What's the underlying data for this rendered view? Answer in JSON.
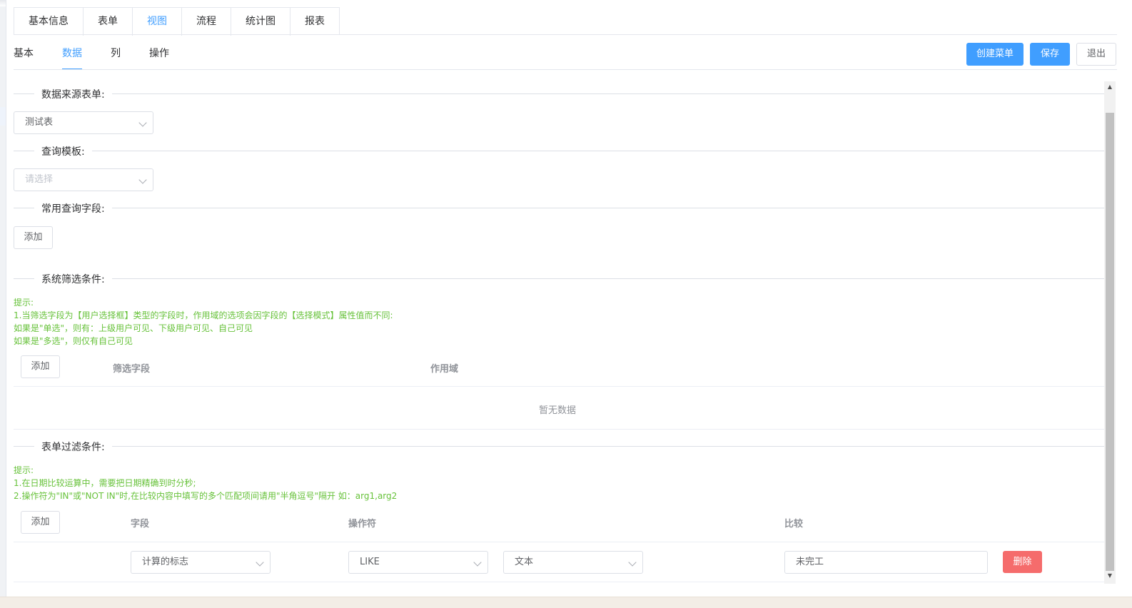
{
  "top_tabs": [
    {
      "label": "基本信息"
    },
    {
      "label": "表单"
    },
    {
      "label": "视图",
      "active": true
    },
    {
      "label": "流程"
    },
    {
      "label": "统计图"
    },
    {
      "label": "报表"
    }
  ],
  "sub_tabs": [
    {
      "label": "基本"
    },
    {
      "label": "数据",
      "active": true
    },
    {
      "label": "列"
    },
    {
      "label": "操作"
    }
  ],
  "toolbar": {
    "create_menu_label": "创建菜单",
    "save_label": "保存",
    "exit_label": "退出"
  },
  "data_source": {
    "section_title": "数据来源表单:",
    "selected_value": "测试表"
  },
  "query_template": {
    "section_title": "查询模板:",
    "placeholder": "请选择"
  },
  "common_query_fields": {
    "section_title": "常用查询字段:",
    "add_label": "添加"
  },
  "system_filter": {
    "section_title": "系统筛选条件:",
    "hint_lines": [
      "提示:",
      "1.当筛选字段为【用户选择框】类型的字段时，作用域的选项会因字段的【选择模式】属性值而不同:",
      "如果是\"单选\"，则有：上级用户可见、下级用户可见、自己可见",
      "如果是\"多选\"，则仅有自己可见"
    ],
    "add_label": "添加",
    "columns": [
      "筛选字段",
      "作用域"
    ],
    "empty_text": "暂无数据"
  },
  "form_filter": {
    "section_title": "表单过滤条件:",
    "hint_lines": [
      "提示:",
      "1.在日期比较运算中，需要把日期精确到时分秒;",
      "2.操作符为\"IN\"或\"NOT IN\"时,在比较内容中填写的多个匹配项间请用\"半角逗号\"隔开 如：arg1,arg2"
    ],
    "add_label": "添加",
    "columns": [
      "字段",
      "操作符",
      "比较"
    ],
    "rows": [
      {
        "field": "计算的标志",
        "operator": "LIKE",
        "value_type": "文本",
        "compare_value": "未完工",
        "delete_label": "删除"
      }
    ]
  },
  "colors": {
    "primary": "#409eff",
    "danger": "#f56c6c",
    "hint_green": "#67c23a"
  }
}
